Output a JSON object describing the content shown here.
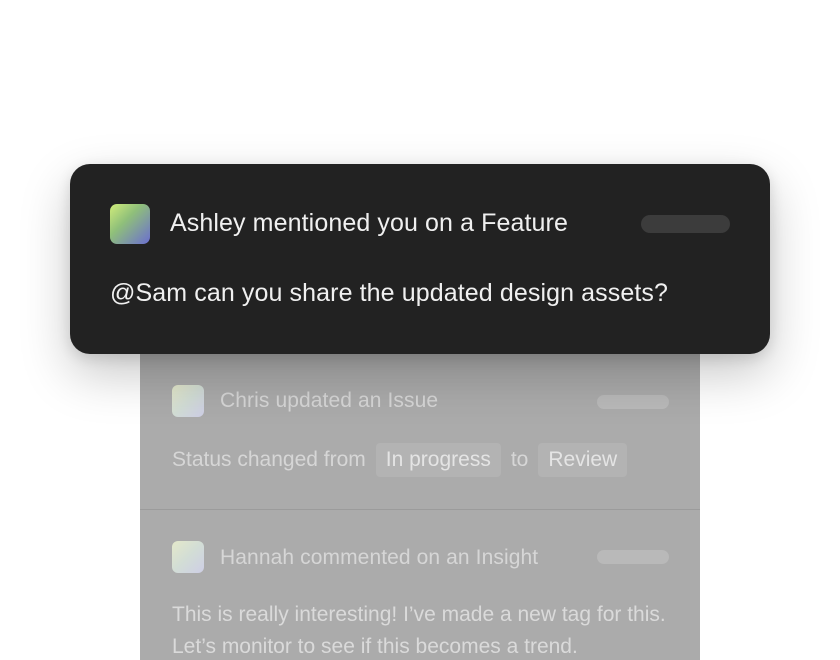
{
  "notification": {
    "title": "Ashley mentioned you on a Feature",
    "message": "@Sam can you share the updated design assets?"
  },
  "feed": {
    "items": [
      {
        "title": "Chris updated an Issue",
        "status_prefix": "Status changed from",
        "from_status": "In progress",
        "connector": "to",
        "to_status": "Review"
      },
      {
        "title": "Hannah commented on an Insight",
        "body": "This is really interesting! I’ve made a new tag for this. Let’s monitor to see if this becomes a trend."
      }
    ]
  },
  "colors": {
    "card_background": "#222222",
    "feed_background": "#ababab",
    "avatar_gradient_start": "#d0ec7a",
    "avatar_gradient_end": "#6b6ed1"
  }
}
